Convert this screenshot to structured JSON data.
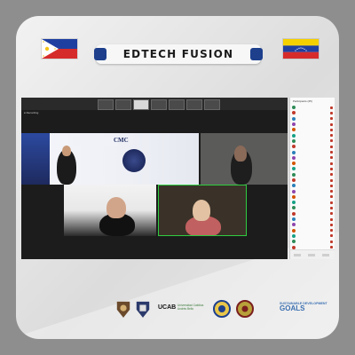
{
  "header": {
    "title": "EDTECH FUSION"
  },
  "flags": [
    "philippines-flag",
    "venezuela-flag"
  ],
  "meeting": {
    "participants_panel_title": "Participants (25)",
    "recording_label": "● Recording",
    "tiles": [
      {
        "slide_text": "CMC"
      }
    ],
    "participants": [
      "",
      "",
      "",
      "",
      "",
      "",
      "",
      "",
      "",
      "",
      "",
      "",
      "",
      "",
      "",
      "",
      "",
      "",
      "",
      "",
      "",
      "",
      "",
      "",
      "",
      ""
    ]
  },
  "footer": {
    "ucab": "UCAB",
    "ucab_sub": "Universidad Católica Andrés Bello",
    "sdg_line": "SUSTAINABLE DEVELOPMENT",
    "sdg_goals": "GOALS"
  },
  "colors": {
    "accent_blue": "#1d3f8c",
    "active_speaker": "#2ecc40",
    "meeting_bg": "#1c1c1c"
  }
}
